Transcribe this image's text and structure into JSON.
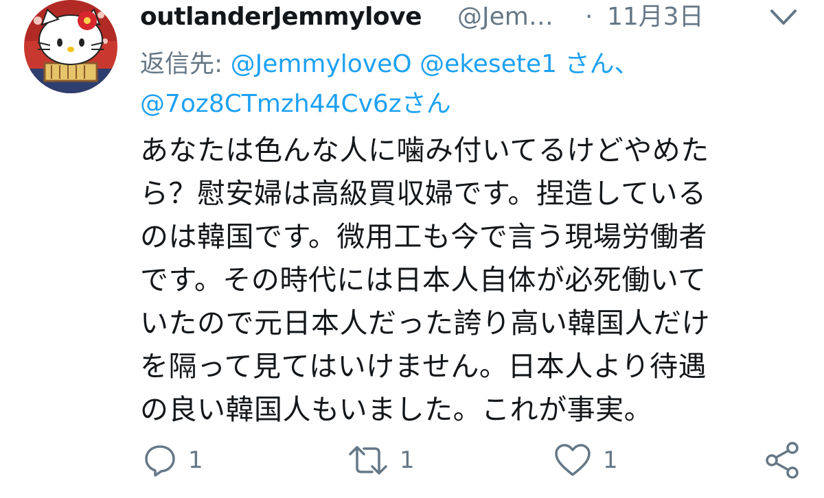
{
  "tweet": {
    "display_name": "outlanderJemmylove",
    "handle": "@Jem…",
    "separator": "·",
    "date": "11月3日",
    "reply_prefix": "返信先: ",
    "reply_mention_1": "@JemmyloveO",
    "reply_mention_2": "@ekesete1",
    "reply_mid": " さん、",
    "reply_mention_3": "@7oz8CTmzh44Cv6z",
    "reply_suffix": "さん",
    "body_lines": [
      "あなたは色んな人に噛み付いてるけどやめた",
      "ら？慰安婦は高級買収婦です。捏造している",
      "のは韓国です。微用工も今で言う現場労働者",
      "です。その時代には日本人自体が必死働いて",
      "いたので元日本人だった誇り高い韓国人だけ",
      "を隔って見てはいけません。日本人より待遇",
      "の良い韓国人もいました。これが事実。"
    ]
  },
  "actions": {
    "reply_icon": "reply-icon",
    "reply_count": "1",
    "retweet_icon": "retweet-icon",
    "retweet_count": "1",
    "like_icon": "heart-icon",
    "like_count": "1",
    "share_icon": "share-icon"
  },
  "colors": {
    "text": "#14171a",
    "secondary": "#657786",
    "link": "#1da1f2"
  }
}
